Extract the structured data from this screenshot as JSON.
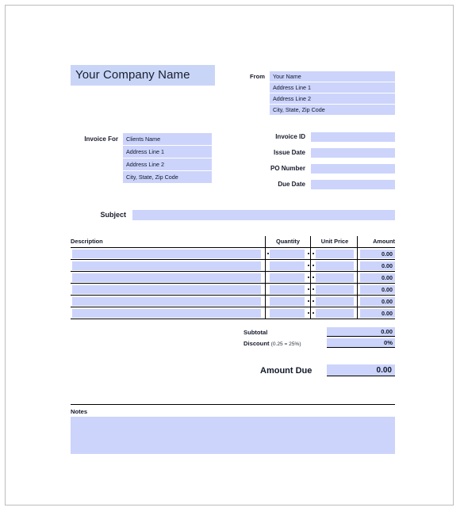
{
  "document": {
    "type": "invoice-template",
    "company_name": "Your Company Name"
  },
  "colors": {
    "field_fill": "#ccd4fb",
    "header_fill": "#c9d5f7",
    "rule": "#000000",
    "page_border": "#bcbcbc"
  },
  "from": {
    "label": "From",
    "lines": [
      "Your Name",
      "Address Line 1",
      "Address Line 2",
      "City, State, Zip Code"
    ]
  },
  "invoice_for": {
    "label": "Invoice For",
    "lines": [
      "Clients Name",
      "Address Line 1",
      "Address Line 2",
      "City, State, Zip Code"
    ]
  },
  "meta": {
    "rows": [
      {
        "label": "Invoice ID",
        "value": ""
      },
      {
        "label": "Issue Date",
        "value": ""
      },
      {
        "label": "PO Number",
        "value": ""
      },
      {
        "label": "Due Date",
        "value": ""
      }
    ]
  },
  "subject": {
    "label": "Subject",
    "value": ""
  },
  "items_table": {
    "columns": [
      "Description",
      "Quantity",
      "Unit Price",
      "Amount"
    ],
    "rows": [
      {
        "description": "",
        "quantity": "",
        "unit_price": "",
        "amount": "0.00"
      },
      {
        "description": "",
        "quantity": "",
        "unit_price": "",
        "amount": "0.00"
      },
      {
        "description": "",
        "quantity": "",
        "unit_price": "",
        "amount": "0.00"
      },
      {
        "description": "",
        "quantity": "",
        "unit_price": "",
        "amount": "0.00"
      },
      {
        "description": "",
        "quantity": "",
        "unit_price": "",
        "amount": "0.00"
      },
      {
        "description": "",
        "quantity": "",
        "unit_price": "",
        "amount": "0.00"
      }
    ]
  },
  "totals": {
    "subtotal_label": "Subtotal",
    "subtotal_value": "0.00",
    "discount_label": "Discount",
    "discount_hint": "(0.25 = 25%)",
    "discount_value": "0%",
    "amount_due_label": "Amount Due",
    "amount_due_value": "0.00"
  },
  "notes": {
    "label": "Notes",
    "value": ""
  }
}
